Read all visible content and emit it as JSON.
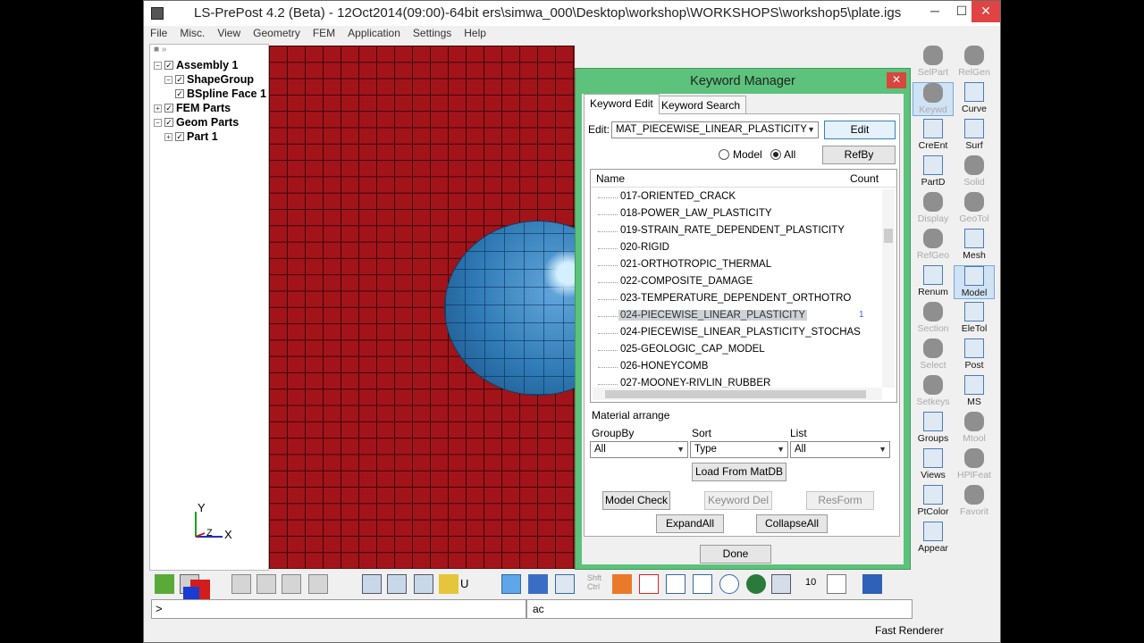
{
  "window": {
    "title": "LS-PrePost 4.2 (Beta) - 12Oct2014(09:00)-64bit ers\\simwa_000\\Desktop\\workshop\\WORKSHOPS\\workshop5\\plate.igs",
    "min_glyph": "─",
    "max_glyph": "☐",
    "close_glyph": "✕"
  },
  "menu": [
    "File",
    "Misc.",
    "View",
    "Geometry",
    "FEM",
    "Application",
    "Settings",
    "Help"
  ],
  "tree": {
    "top_glyphs": "■  »",
    "items": [
      {
        "label": "Assembly 1",
        "level": 0
      },
      {
        "label": "ShapeGroup",
        "level": 1
      },
      {
        "label": "BSpline Face 1",
        "level": 2
      },
      {
        "label": "FEM Parts",
        "level": 0
      },
      {
        "label": "Geom Parts",
        "level": 0
      },
      {
        "label": "Part 1",
        "level": 1
      }
    ]
  },
  "axes": {
    "y": "Y",
    "x": "X",
    "z": "Z"
  },
  "dialog": {
    "title": "Keyword Manager",
    "close_glyph": "✕",
    "tabs": [
      "Keyword Edit",
      "Keyword Search"
    ],
    "edit_label": "Edit:",
    "edit_value": "MAT_PIECEWISE_LINEAR_PLASTICITY",
    "edit_button": "Edit",
    "radio_model": "Model",
    "radio_all": "All",
    "radio_selected": "All",
    "refby_button": "RefBy",
    "list_header": {
      "name": "Name",
      "count": "Count"
    },
    "rows": [
      {
        "name": "017-ORIENTED_CRACK",
        "count": ""
      },
      {
        "name": "018-POWER_LAW_PLASTICITY",
        "count": ""
      },
      {
        "name": "019-STRAIN_RATE_DEPENDENT_PLASTICITY",
        "count": ""
      },
      {
        "name": "020-RIGID",
        "count": ""
      },
      {
        "name": "021-ORTHOTROPIC_THERMAL",
        "count": ""
      },
      {
        "name": "022-COMPOSITE_DAMAGE",
        "count": ""
      },
      {
        "name": "023-TEMPERATURE_DEPENDENT_ORTHOTRO",
        "count": ""
      },
      {
        "name": "024-PIECEWISE_LINEAR_PLASTICITY",
        "count": "1",
        "selected": true
      },
      {
        "name": "024-PIECEWISE_LINEAR_PLASTICITY_STOCHAS",
        "count": ""
      },
      {
        "name": "025-GEOLOGIC_CAP_MODEL",
        "count": ""
      },
      {
        "name": "026-HONEYCOMB",
        "count": ""
      },
      {
        "name": "027-MOONEY-RIVLIN_RUBBER",
        "count": ""
      }
    ],
    "material_arrange_label": "Material arrange",
    "groupby_label": "GroupBy",
    "groupby_value": "All",
    "sort_label": "Sort",
    "sort_value": "Type",
    "list_label": "List",
    "list_value": "All",
    "load_button": "Load From MatDB",
    "model_check_button": "Model Check",
    "keyword_del_button": "Keyword Del",
    "resform_button": "ResForm",
    "expand_button": "ExpandAll",
    "collapse_button": "CollapseAll",
    "done_button": "Done"
  },
  "right_tools": [
    {
      "label": "SelPart",
      "gray": true
    },
    {
      "label": "RelGen",
      "gray": true
    },
    {
      "label": "Keywd",
      "gray": true,
      "selected": true
    },
    {
      "label": "Curve",
      "gray": false
    },
    {
      "label": "CreEnt",
      "gray": false
    },
    {
      "label": "Surf",
      "gray": false
    },
    {
      "label": "PartD",
      "gray": false
    },
    {
      "label": "Solid",
      "gray": true
    },
    {
      "label": "Display",
      "gray": true
    },
    {
      "label": "GeoTol",
      "gray": true
    },
    {
      "label": "RefGeo",
      "gray": true
    },
    {
      "label": "Mesh",
      "gray": false
    },
    {
      "label": "Renum",
      "gray": false
    },
    {
      "label": "Model",
      "gray": false,
      "selected": true
    },
    {
      "label": "Section",
      "gray": true
    },
    {
      "label": "EleTol",
      "gray": false
    },
    {
      "label": "Select",
      "gray": true
    },
    {
      "label": "Post",
      "gray": false
    },
    {
      "label": "Setkeys",
      "gray": true
    },
    {
      "label": "MS",
      "gray": false
    },
    {
      "label": "Groups",
      "gray": false
    },
    {
      "label": "Mtool",
      "gray": true
    },
    {
      "label": "Views",
      "gray": false
    },
    {
      "label": "HPlFeat",
      "gray": true
    },
    {
      "label": "PtColor",
      "gray": false
    },
    {
      "label": "Favorit",
      "gray": true
    },
    {
      "label": "Appear",
      "gray": false
    }
  ],
  "right_tools_extra": "Renum",
  "bottom": {
    "shft_ctrl": "Shft\nCtrl",
    "num": "10",
    "cmd_prompt": ">",
    "cmd2_value": "ac",
    "status": "Fast Renderer",
    "toolbar_u": "U"
  },
  "colors": {
    "plate": "#a3141a",
    "sphere": "#3b84c2",
    "dialog_frame": "#5cc27c",
    "win_close": "#e04343"
  }
}
